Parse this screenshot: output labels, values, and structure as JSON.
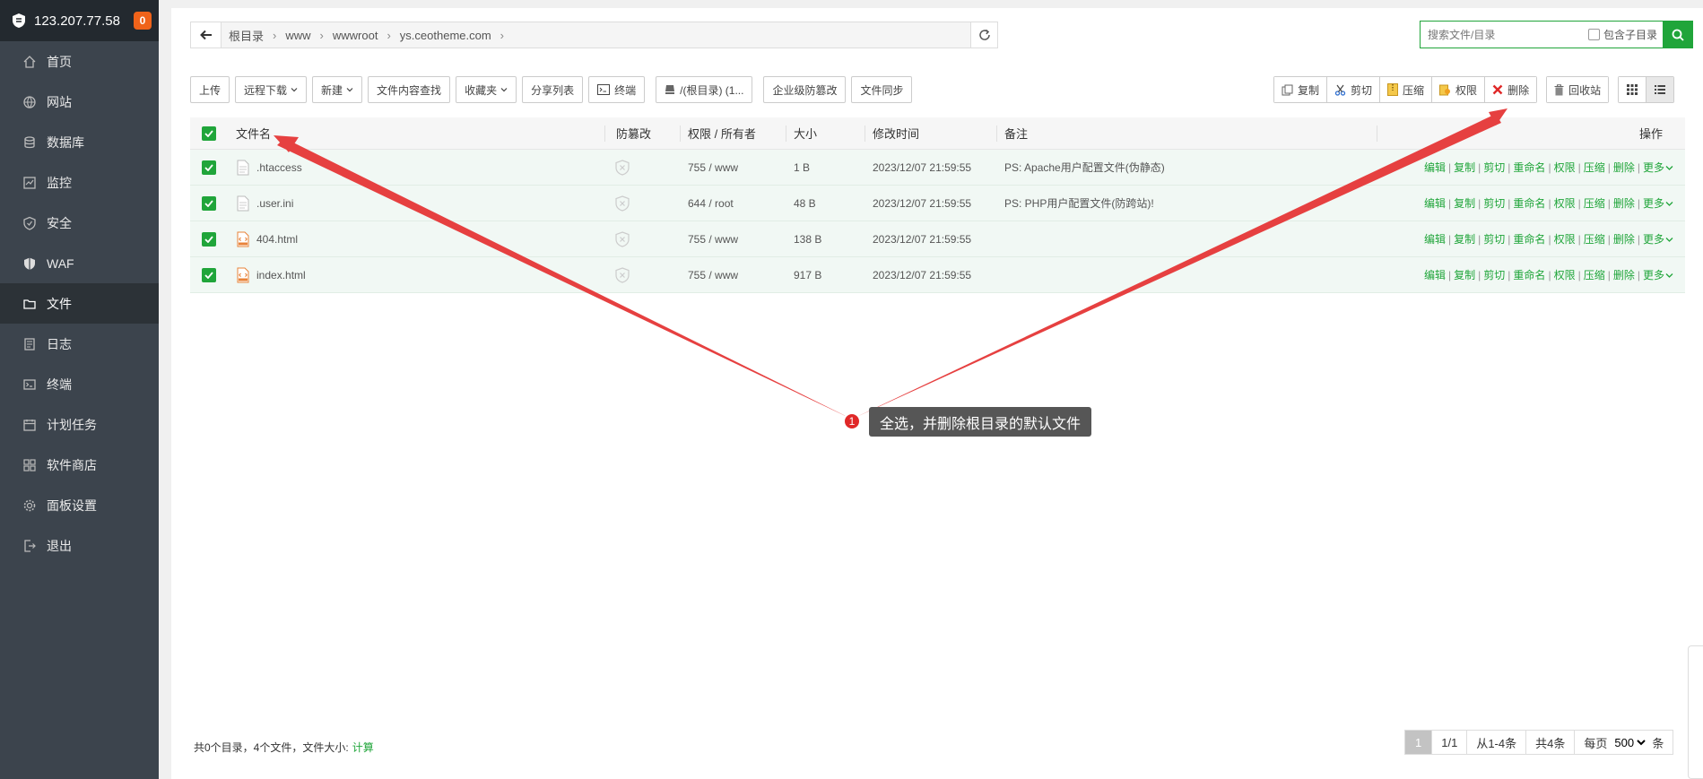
{
  "sidebar": {
    "server_ip": "123.207.77.58",
    "badge": "0",
    "items": [
      {
        "label": "首页",
        "icon": "home-icon"
      },
      {
        "label": "网站",
        "icon": "globe-icon"
      },
      {
        "label": "数据库",
        "icon": "database-icon"
      },
      {
        "label": "监控",
        "icon": "monitor-icon"
      },
      {
        "label": "安全",
        "icon": "shield-icon"
      },
      {
        "label": "WAF",
        "icon": "waf-shield-icon"
      },
      {
        "label": "文件",
        "icon": "folder-icon",
        "active": true
      },
      {
        "label": "日志",
        "icon": "log-icon"
      },
      {
        "label": "终端",
        "icon": "terminal-icon"
      },
      {
        "label": "计划任务",
        "icon": "calendar-icon"
      },
      {
        "label": "软件商店",
        "icon": "apps-icon"
      },
      {
        "label": "面板设置",
        "icon": "gear-icon"
      },
      {
        "label": "退出",
        "icon": "logout-icon"
      }
    ]
  },
  "path": {
    "crumbs": [
      "根目录",
      "www",
      "wwwroot",
      "ys.ceotheme.com"
    ]
  },
  "search": {
    "placeholder": "搜索文件/目录",
    "include_sub_label": "包含子目录"
  },
  "toolbar": {
    "upload": "上传",
    "remote_download": "远程下载",
    "new": "新建",
    "content_search": "文件内容查找",
    "favorites": "收藏夹",
    "share_list": "分享列表",
    "terminal": "终端",
    "disk": "/(根目录) (1...",
    "tamper_proof": "企业级防篡改",
    "file_sync": "文件同步",
    "copy": "复制",
    "cut": "剪切",
    "compress": "压缩",
    "permission": "权限",
    "delete": "删除",
    "recycle": "回收站"
  },
  "table": {
    "headers": {
      "name": "文件名",
      "tamper": "防篡改",
      "perm": "权限 / 所有者",
      "size": "大小",
      "mtime": "修改时间",
      "note": "备注",
      "ops": "操作"
    },
    "rows": [
      {
        "name": ".htaccess",
        "type": "text",
        "perm": "755 / www",
        "size": "1 B",
        "mtime": "2023/12/07 21:59:55",
        "note": "PS: Apache用户配置文件(伪静态)"
      },
      {
        "name": ".user.ini",
        "type": "text",
        "perm": "644 / root",
        "size": "48 B",
        "mtime": "2023/12/07 21:59:55",
        "note": "PS: PHP用户配置文件(防跨站)!"
      },
      {
        "name": "404.html",
        "type": "html",
        "perm": "755 / www",
        "size": "138 B",
        "mtime": "2023/12/07 21:59:55",
        "note": ""
      },
      {
        "name": "index.html",
        "type": "html",
        "perm": "755 / www",
        "size": "917 B",
        "mtime": "2023/12/07 21:59:55",
        "note": ""
      }
    ],
    "ops": {
      "edit": "编辑",
      "copy": "复制",
      "cut": "剪切",
      "rename": "重命名",
      "perm": "权限",
      "compress": "压缩",
      "delete": "删除",
      "more": "更多"
    }
  },
  "footer": {
    "summary": "共0个目录，4个文件，文件大小:",
    "calc": "计算",
    "page_current": "1",
    "page_total": "1/1",
    "range": "从1-4条",
    "count": "共4条",
    "per_page_label": "每页",
    "per_page": "500",
    "unit": "条"
  },
  "annotation": {
    "number": "1",
    "text": "全选，并删除根目录的默认文件",
    "color": "#e02828"
  },
  "colors": {
    "accent": "#20a53a",
    "sidebar": "#3c444d",
    "row_bg": "#f1f8f4"
  }
}
